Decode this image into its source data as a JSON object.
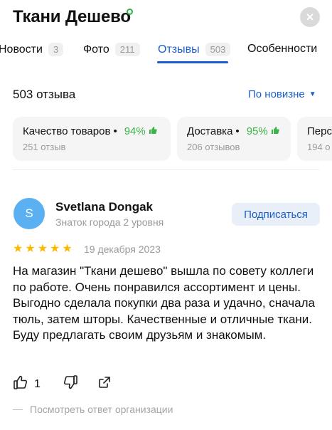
{
  "header": {
    "title": "Ткани Дешево",
    "close_glyph": "×"
  },
  "tabs": [
    {
      "label": "Новости",
      "count": "3",
      "active": false
    },
    {
      "label": "Фото",
      "count": "211",
      "active": false
    },
    {
      "label": "Отзывы",
      "count": "503",
      "active": true
    },
    {
      "label": "Особенности",
      "count": "",
      "active": false
    }
  ],
  "summary": {
    "count_title": "503 отзыва",
    "sort_label": "По новизне",
    "sort_caret": "▼"
  },
  "rating_cards": [
    {
      "title": "Качество товаров",
      "percent": "94%",
      "sub": "251 отзыв"
    },
    {
      "title": "Доставка",
      "percent": "95%",
      "sub": "206 отзывов"
    },
    {
      "title": "Перс",
      "percent": "",
      "sub": "194 о"
    }
  ],
  "review": {
    "avatar_letter": "S",
    "author": "Svetlana Dongak",
    "author_level": "Знаток города 2 уровня",
    "subscribe_label": "Подписаться",
    "stars": 5,
    "date": "19 декабря 2023",
    "text": "На магазин \"Ткани дешево\" вышла по совету коллеги по работе. Очень понравился ассортимент и цены. Выгодно сделала покупки два раза и удачно, сначала тюль, затем шторы. Качественные и отличные ткани. Буду предлагать своим друзьям и знакомым.",
    "likes": "1",
    "org_reply_label": "Посмотреть ответ организации"
  },
  "colors": {
    "accent": "#1a5fc9",
    "positive": "#3bb34a",
    "star": "#fcb900",
    "avatar": "#5ab0f0"
  },
  "icons": {
    "verified": "verified-icon",
    "like": "thumbs-up-icon",
    "dislike": "thumbs-down-icon",
    "share": "share-icon",
    "card_thumb": "thumbs-up-icon"
  }
}
